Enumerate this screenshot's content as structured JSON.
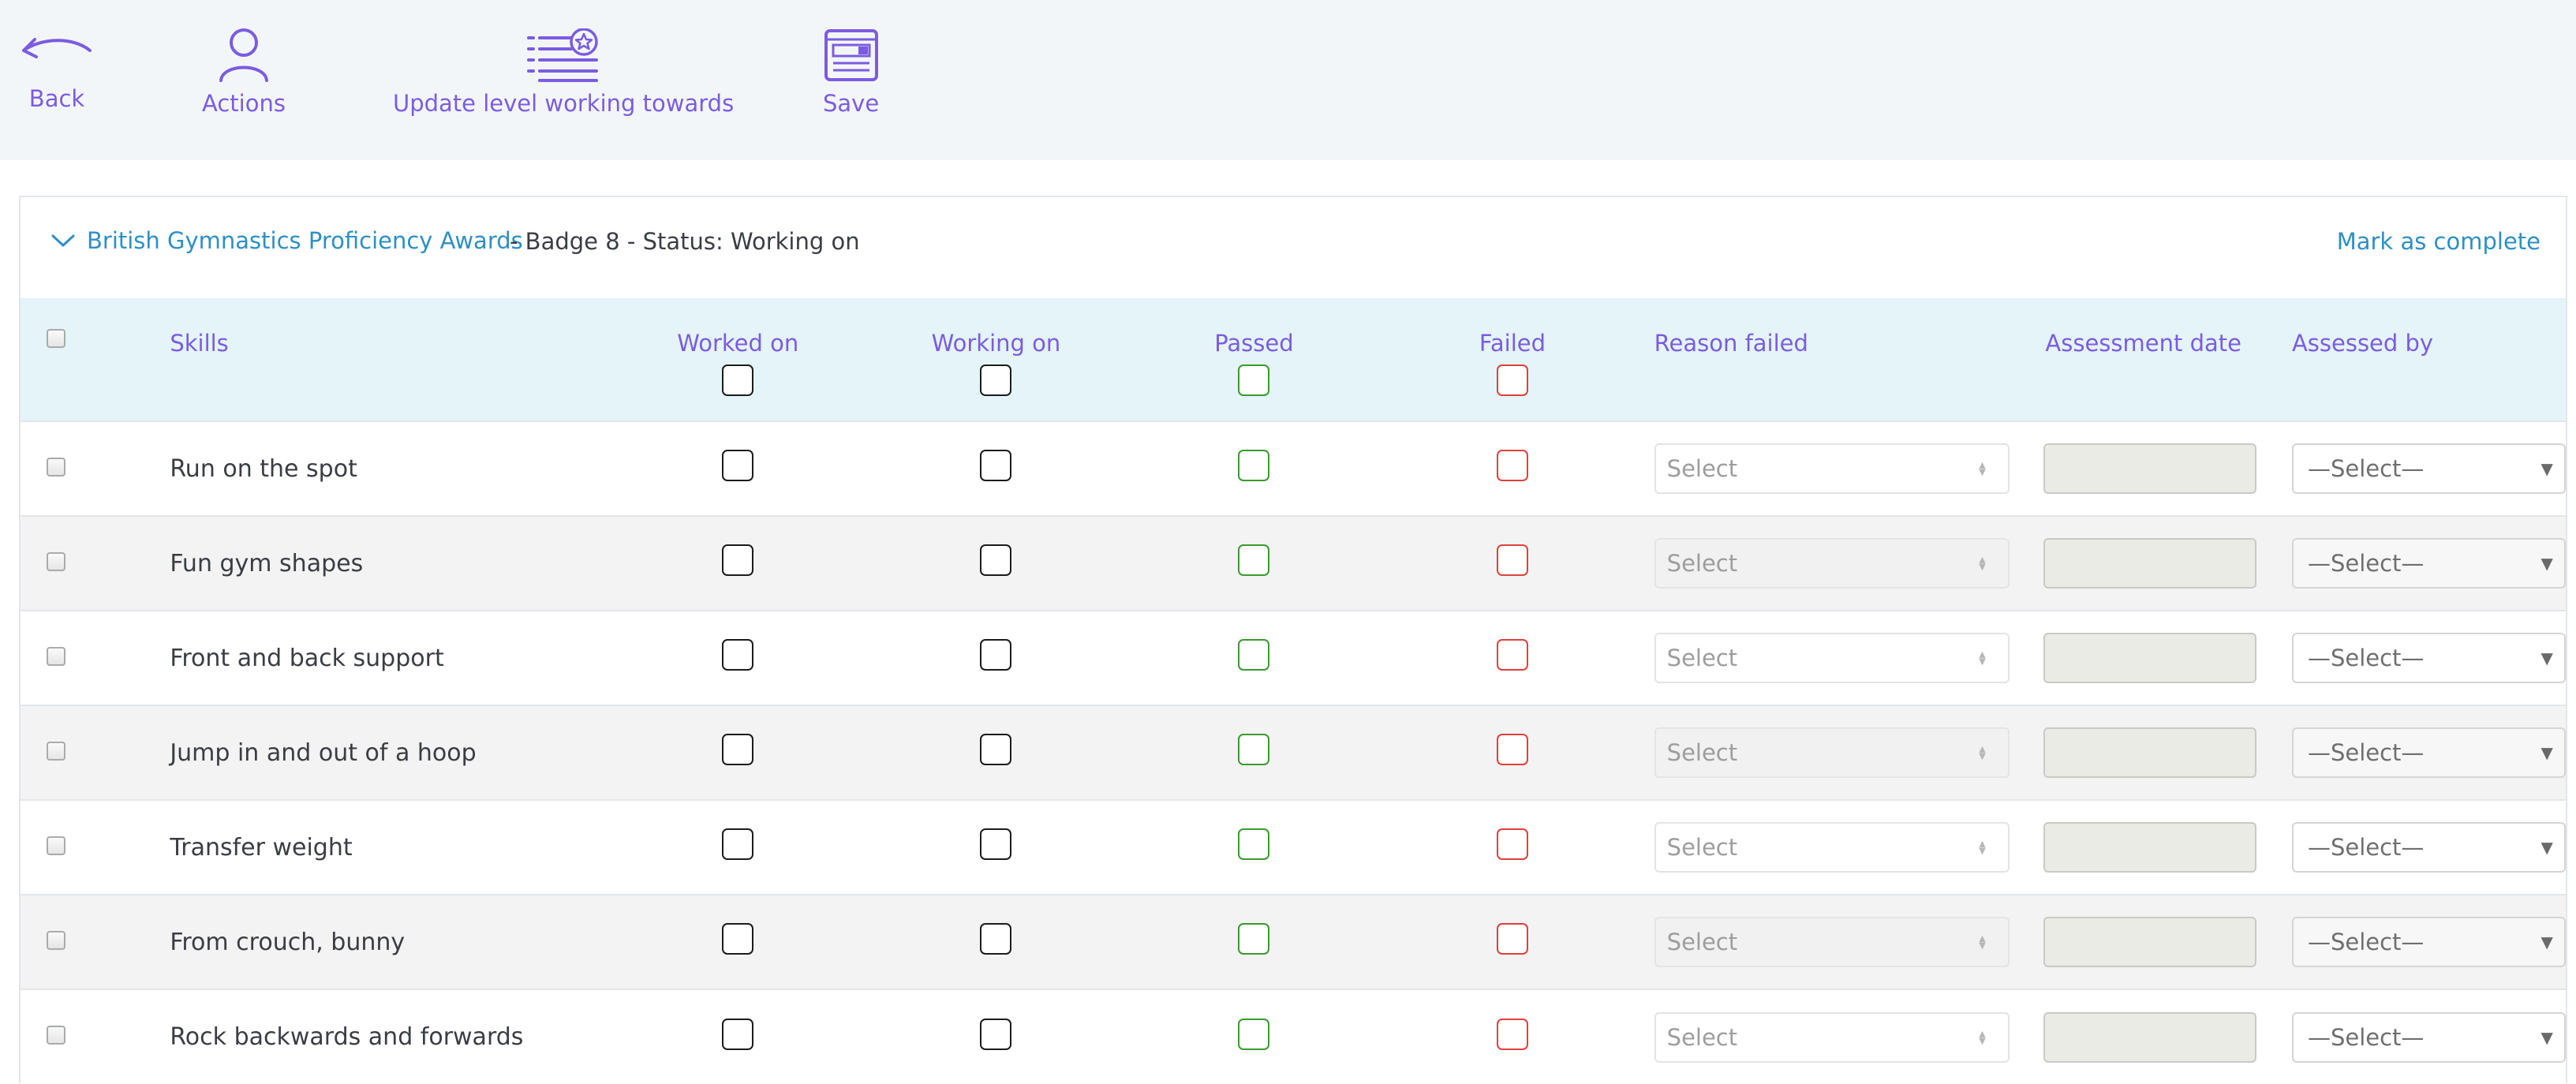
{
  "toolbar": {
    "back_label": "Back",
    "actions_label": "Actions",
    "update_label": "Update level working towards",
    "save_label": "Save"
  },
  "panel": {
    "title": "British Gymnastics Proficiency Awards",
    "status_text": "- Badge 8 - Status: Working on",
    "mark_complete": "Mark as complete"
  },
  "table": {
    "headers": {
      "skills": "Skills",
      "worked_on": "Worked on",
      "working_on": "Working on",
      "passed": "Passed",
      "failed": "Failed",
      "reason_failed": "Reason failed",
      "assessment_date": "Assessment date",
      "assessed_by": "Assessed by"
    },
    "rows": [
      {
        "skill": "Run on the spot",
        "reason": "Select",
        "assessed_by": "—Select—"
      },
      {
        "skill": "Fun gym shapes",
        "reason": "Select",
        "assessed_by": "—Select—"
      },
      {
        "skill": "Front and back support",
        "reason": "Select",
        "assessed_by": "—Select—"
      },
      {
        "skill": "Jump in and out of a hoop",
        "reason": "Select",
        "assessed_by": "—Select—"
      },
      {
        "skill": "Transfer weight",
        "reason": "Select",
        "assessed_by": "—Select—"
      },
      {
        "skill": "From crouch, bunny",
        "reason": "Select",
        "assessed_by": "—Select—"
      },
      {
        "skill": "Rock backwards and forwards",
        "reason": "Select",
        "assessed_by": "—Select—"
      }
    ]
  },
  "colors": {
    "accent": "#7b5ce0",
    "link": "#2e8fc5",
    "passed": "#3a9a2e",
    "failed": "#e0403c",
    "header_bg": "#e4f4f8"
  }
}
